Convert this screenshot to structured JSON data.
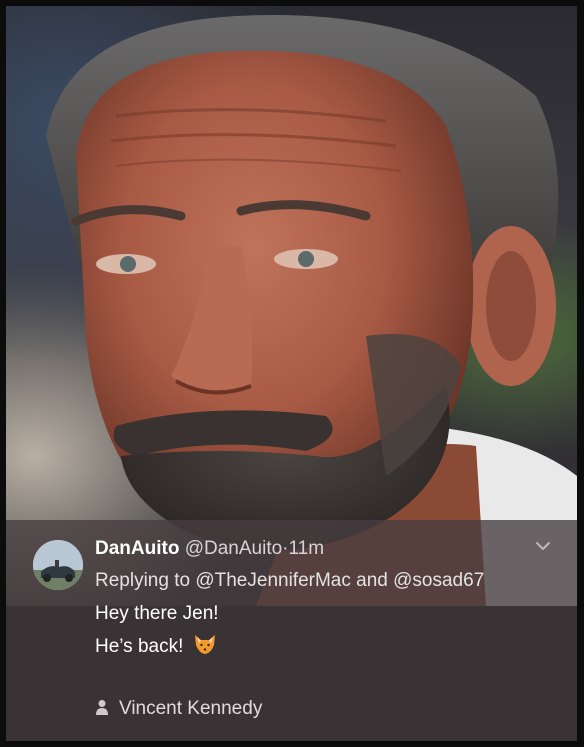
{
  "tweet": {
    "display_name": "DanAuito",
    "handle": "@DanAuito",
    "separator": "·",
    "time": "11m",
    "replying_prefix": "Replying to",
    "reply_mention_1": "@TheJenniferMac",
    "reply_and": "and",
    "reply_mention_2": "@sosad67",
    "body_line_1": "Hey there Jen!",
    "body_line_2": "He’s back!",
    "body_emoji": "fox-face-emoji",
    "menu_icon": "chevron-down-icon"
  },
  "attribution": {
    "icon": "person-icon",
    "name": "Vincent Kennedy"
  },
  "colors": {
    "background": "#3a3335",
    "text": "#ffffff",
    "muted_text": "#d8d4d5"
  }
}
